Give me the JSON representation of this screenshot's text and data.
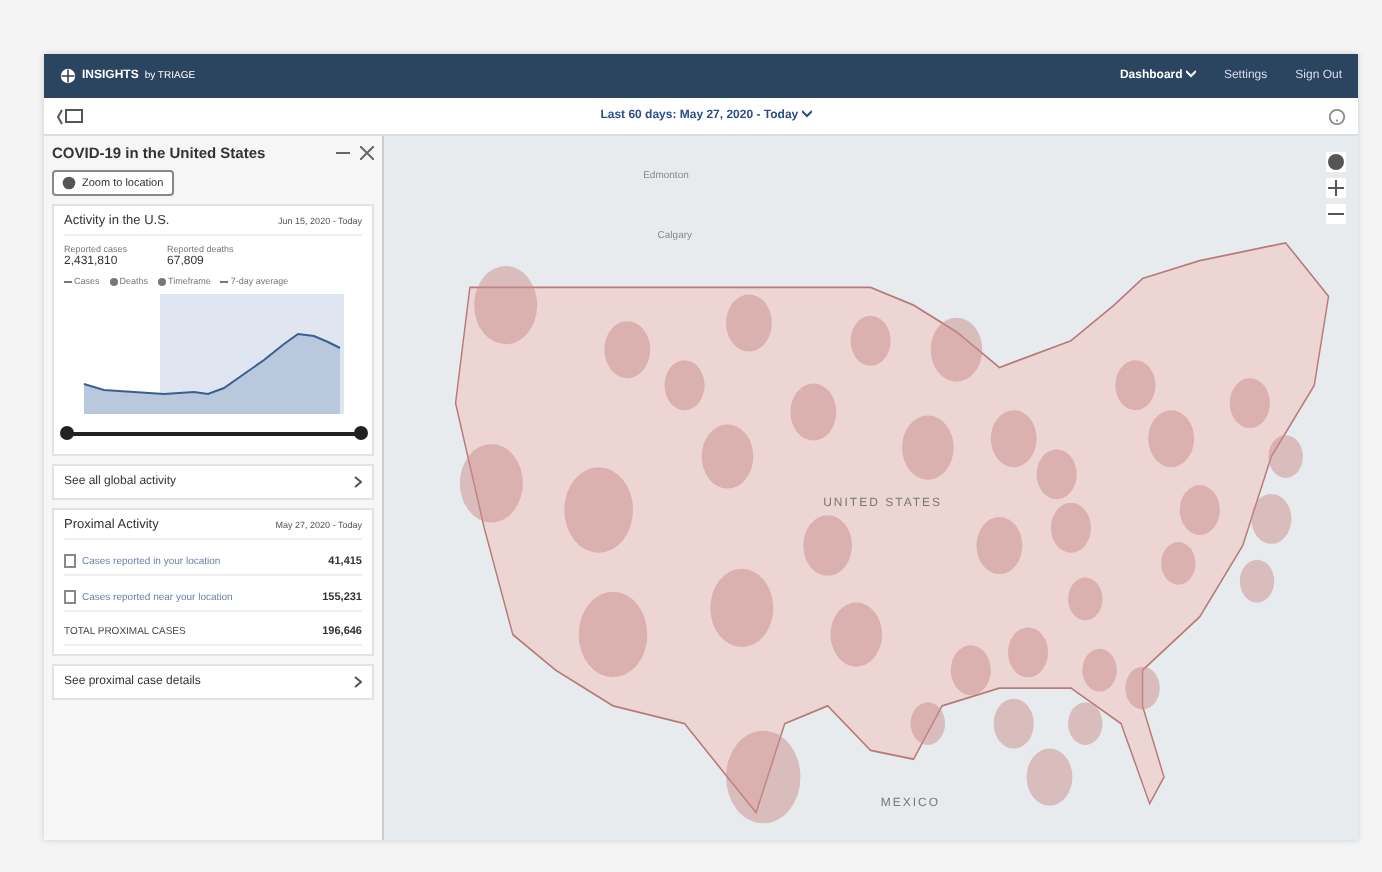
{
  "header": {
    "brand": "INSIGHTS",
    "brand_suffix": "by TRIAGE",
    "nav": [
      {
        "label": "Dashboard",
        "kind": "dropdown"
      },
      {
        "label": "Settings",
        "kind": "link"
      },
      {
        "label": "Sign Out",
        "kind": "link"
      }
    ]
  },
  "date_range": "Last 60 days: May 27, 2020 - Today",
  "panel": {
    "title": "COVID-19 in the United States",
    "zoom_button": "Zoom to location",
    "activity": {
      "title": "Activity in the U.S.",
      "range": "Jun 15, 2020 - Today",
      "stats": [
        {
          "label": "Reported cases",
          "value": "2,431,810"
        },
        {
          "label": "Reported deaths",
          "value": "67,809"
        }
      ],
      "legend": [
        {
          "label": "Cases",
          "kind": "line"
        },
        {
          "label": "Deaths",
          "kind": "dot"
        },
        {
          "label": "Timeframe",
          "kind": "dot"
        },
        {
          "label": "7-day average",
          "kind": "line"
        }
      ],
      "slider": {
        "level": 1
      },
      "link": "See all global activity"
    },
    "proximal": {
      "title": "Proximal Activity",
      "range": "May 27, 2020 - Today",
      "rows": [
        {
          "label": "Cases reported in your location",
          "value": "41,415",
          "kind": "icon"
        },
        {
          "label": "Cases reported near your location",
          "value": "155,231",
          "kind": "icon"
        },
        {
          "label": "TOTAL PROXIMAL CASES",
          "value": "196,646",
          "kind": "total"
        }
      ],
      "link": "See proximal case details"
    }
  },
  "map": {
    "labels": [
      {
        "text": "Edmonton",
        "kind": "city"
      },
      {
        "text": "Calgary",
        "kind": "city"
      },
      {
        "text": "UNITED STATES",
        "kind": "country"
      },
      {
        "text": "MEXICO",
        "kind": "country"
      }
    ]
  }
}
